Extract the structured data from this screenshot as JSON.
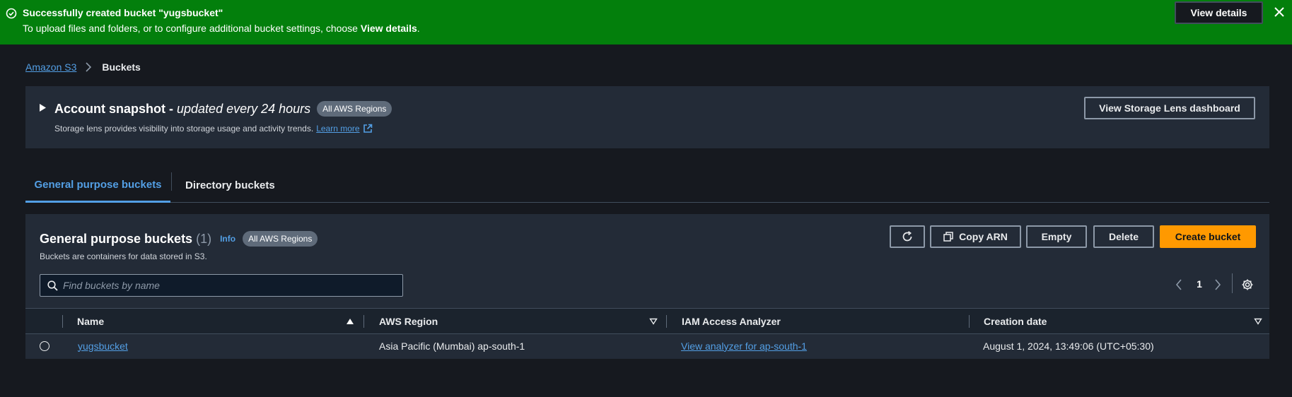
{
  "flash": {
    "title": "Successfully created bucket \"yugsbucket\"",
    "message_prefix": "To upload files and folders, or to configure additional bucket settings, choose ",
    "message_emphasis": "View details",
    "message_suffix": ".",
    "button_label": "View details",
    "icons": {
      "status": "success-check-icon",
      "close": "close-icon"
    },
    "color": "#037f0c"
  },
  "breadcrumb": {
    "items": [
      {
        "label": "Amazon S3"
      },
      {
        "label": "Buckets"
      }
    ]
  },
  "snapshot": {
    "title": "Account snapshot -",
    "subtitle": "updated every 24 hours",
    "badge": "All AWS Regions",
    "description": "Storage lens provides visibility into storage usage and activity trends.",
    "learn_more": "Learn more",
    "button": "View Storage Lens dashboard"
  },
  "tabs": [
    {
      "label": "General purpose buckets",
      "active": true
    },
    {
      "label": "Directory buckets",
      "active": false
    }
  ],
  "buckets": {
    "title": "General purpose buckets",
    "count": "(1)",
    "info": "Info",
    "badge": "All AWS Regions",
    "description": "Buckets are containers for data stored in S3.",
    "buttons": {
      "copy_arn": "Copy ARN",
      "empty": "Empty",
      "delete": "Delete",
      "create": "Create bucket"
    },
    "search_placeholder": "Find buckets by name",
    "pagination": {
      "page": "1"
    },
    "columns": [
      "Name",
      "AWS Region",
      "IAM Access Analyzer",
      "Creation date"
    ],
    "rows": [
      {
        "name": "yugsbucket",
        "region": "Asia Pacific (Mumbai) ap-south-1",
        "analyzer": "View analyzer for ap-south-1",
        "created": "August 1, 2024, 13:49:06 (UTC+05:30)"
      }
    ]
  },
  "colors": {
    "background": "#16191f",
    "panel": "#232b37",
    "link": "#539fe5",
    "primary_button": "#ff9900"
  }
}
